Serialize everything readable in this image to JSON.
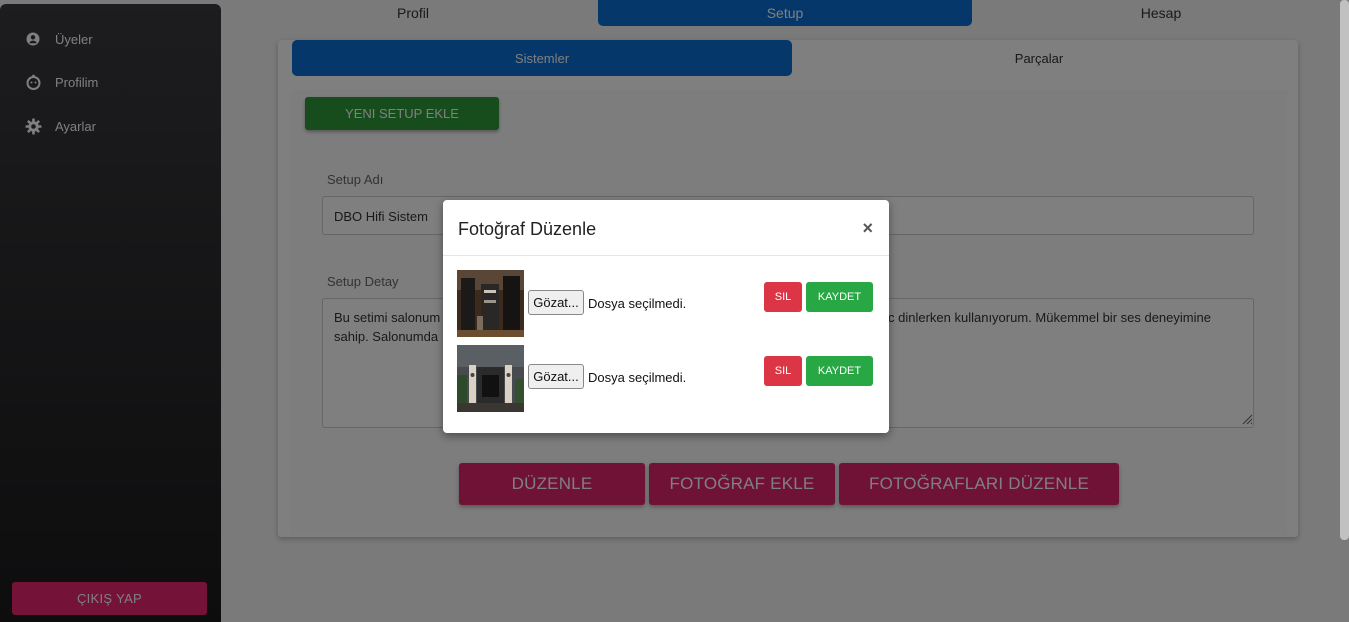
{
  "sidebar": {
    "items": [
      {
        "label": "Üyeler",
        "icon": "user-circle-icon"
      },
      {
        "label": "Profilim",
        "icon": "profile-face-icon"
      },
      {
        "label": "Ayarlar",
        "icon": "gear-icon"
      }
    ],
    "logout_label": "ÇIKIŞ YAP"
  },
  "top_tabs": [
    {
      "label": "Profil",
      "active": false
    },
    {
      "label": "Setup",
      "active": true
    },
    {
      "label": "Hesap",
      "active": false
    }
  ],
  "sub_tabs": [
    {
      "label": "Sistemler",
      "active": true
    },
    {
      "label": "Parçalar",
      "active": false
    }
  ],
  "main": {
    "new_setup_label": "YENI SETUP EKLE",
    "setup_name_label": "Setup Adı",
    "setup_name_value": "DBO Hifi Sistem",
    "setup_detail_label": "Setup Detay",
    "setup_detail_left": "Bu setimi salonum",
    "setup_detail_left_2": "sahip. Salonumda",
    "setup_detail_right": "c dinlerken kullanıyorum. Mükemmel bir ses deneyimine",
    "buttons": {
      "edit": "DÜZENLE",
      "add_photo": "FOTOĞRAF EKLE",
      "edit_photos": "FOTOĞRAFLARI DÜZENLE"
    }
  },
  "modal": {
    "title": "Fotoğraf Düzenle",
    "close": "×",
    "rows": [
      {
        "browse": "Gözat...",
        "file_status": "Dosya seçilmedi.",
        "delete": "SIL",
        "save": "KAYDET"
      },
      {
        "browse": "Gözat...",
        "file_status": "Dosya seçilmedi.",
        "delete": "SIL",
        "save": "KAYDET"
      }
    ]
  },
  "colors": {
    "primary": "#0a6fd6",
    "success": "#28a745",
    "danger": "#dc3545",
    "pink": "#e0246a"
  }
}
